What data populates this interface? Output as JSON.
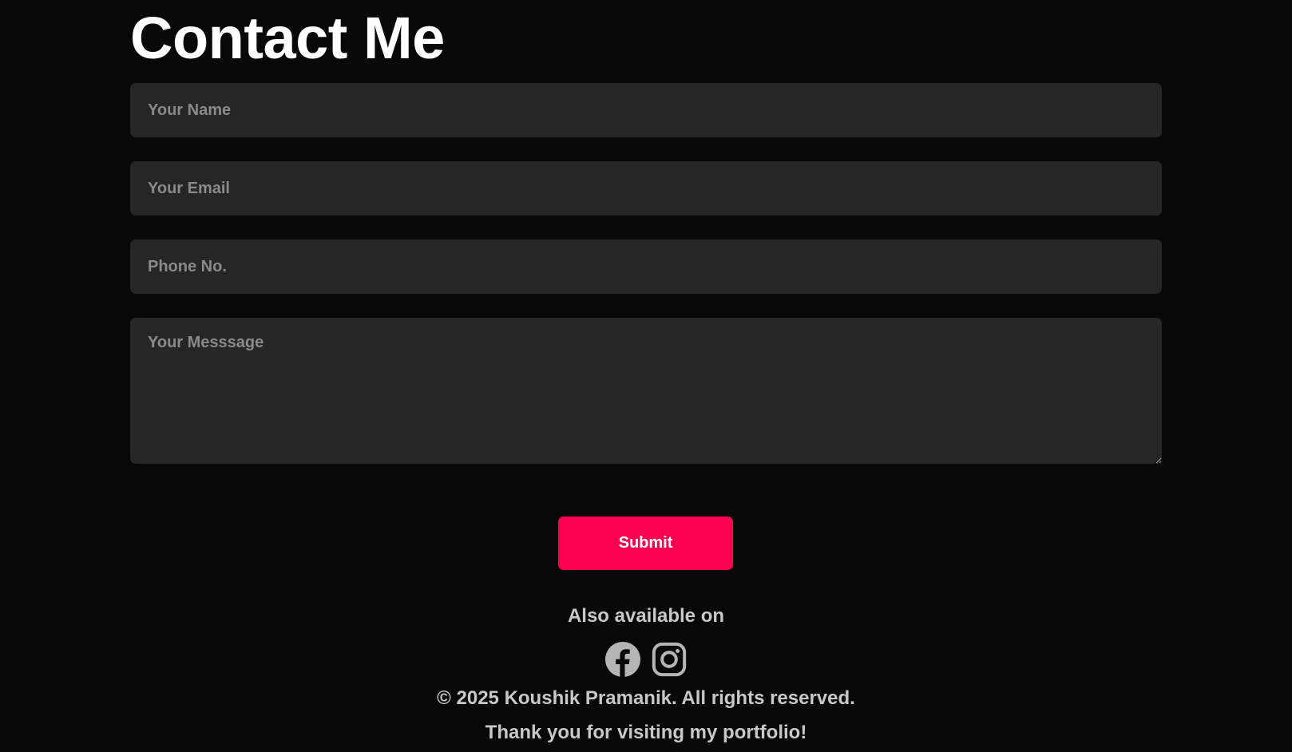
{
  "contact": {
    "title": "Contact Me",
    "name_placeholder": "Your Name",
    "email_placeholder": "Your Email",
    "phone_placeholder": "Phone No.",
    "message_placeholder": "Your Messsage",
    "submit_label": "Submit"
  },
  "footer": {
    "also_available": "Also available on",
    "socials": [
      {
        "icon": "facebook-icon"
      },
      {
        "icon": "instagram-icon"
      }
    ],
    "copyright": "© 2025 Koushik Pramanik. All rights reserved.",
    "thanks": "Thank you for visiting my portfolio!"
  },
  "colors": {
    "background": "#080808",
    "field_background": "#262626",
    "accent": "#ff0050",
    "muted_text": "#c8c8c8"
  }
}
